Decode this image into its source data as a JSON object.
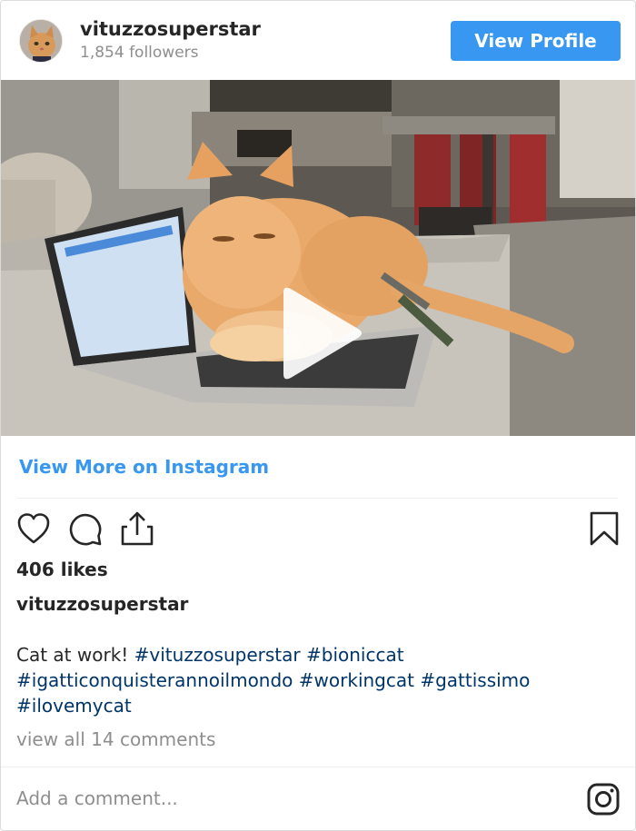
{
  "header": {
    "username": "vituzzosuperstar",
    "followers": "1,854 followers",
    "view_profile_label": "View Profile"
  },
  "media": {
    "description_icon": "play-icon"
  },
  "view_more_label": "View More on Instagram",
  "actions": {
    "icons": [
      "heart-icon",
      "comment-icon",
      "share-icon",
      "bookmark-icon"
    ]
  },
  "likes": "406 likes",
  "post": {
    "owner": "vituzzosuperstar",
    "caption_text": "Cat at work! ",
    "hashtags": [
      "#vituzzosuperstar",
      "#bioniccat",
      "#igatticonquisterannoilmondo",
      "#workingcat",
      "#gattissimo",
      "#ilovemycat"
    ],
    "view_comments": "view all 14 comments"
  },
  "comment_box": {
    "placeholder": "Add a comment..."
  },
  "colors": {
    "accent": "#3897f0",
    "hashtag": "#003569",
    "muted": "#8e8e8e",
    "text": "#262626"
  }
}
